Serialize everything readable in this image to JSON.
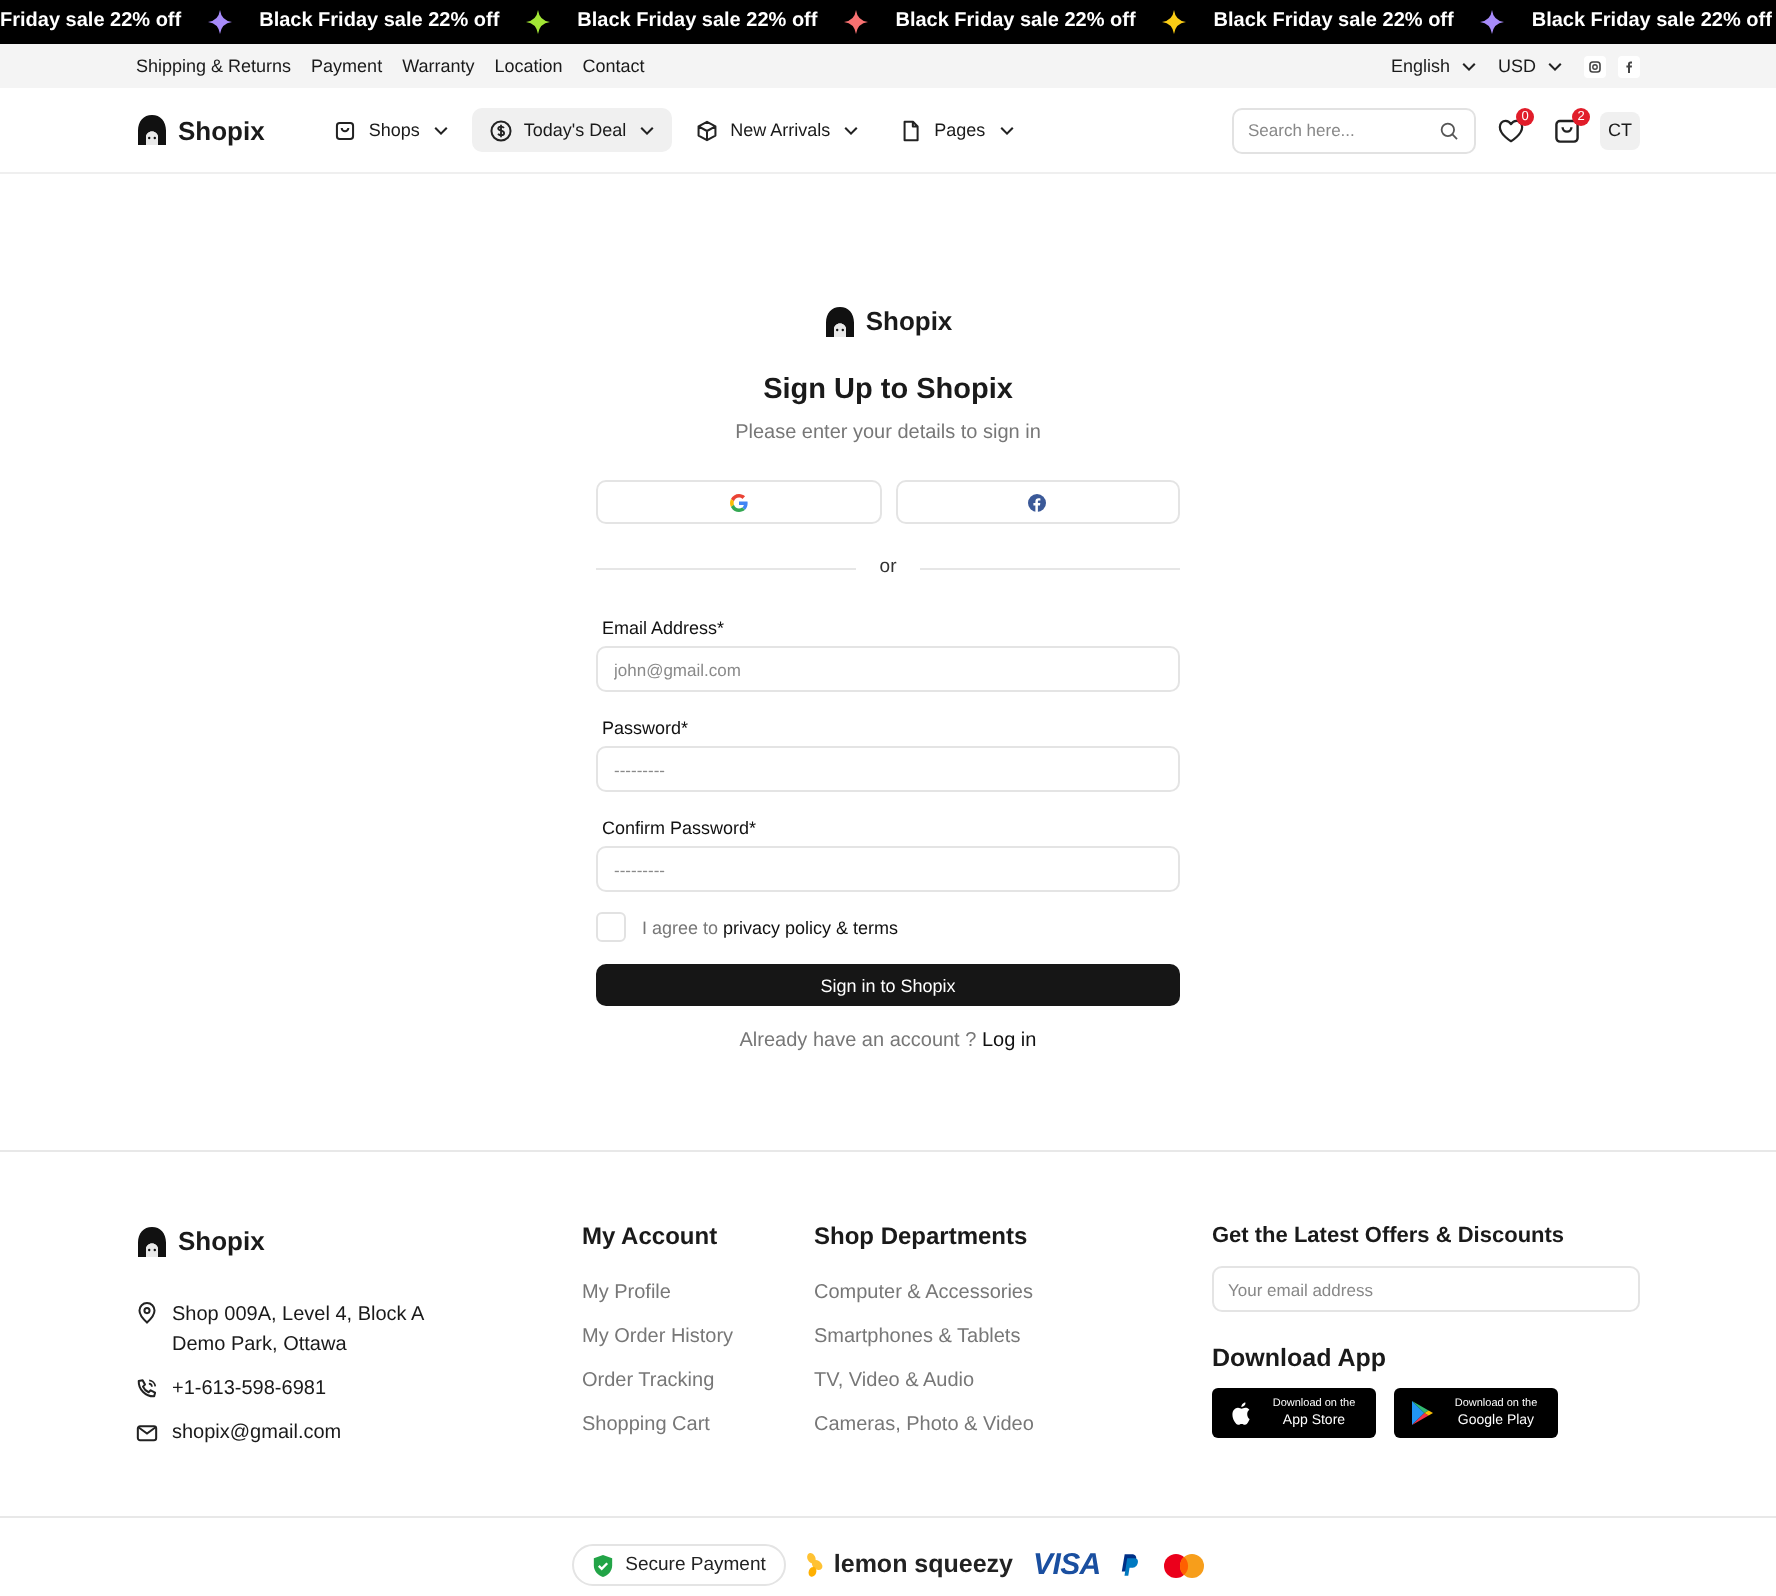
{
  "ticker": {
    "items": [
      {
        "kind": "text",
        "text": "Friday sale 22% off"
      },
      {
        "kind": "star",
        "color": "#a78bfa"
      },
      {
        "kind": "text",
        "text": "Black Friday sale 22% off"
      },
      {
        "kind": "star",
        "color": "#a3e635"
      },
      {
        "kind": "text",
        "text": "Black Friday sale 22% off"
      },
      {
        "kind": "star",
        "color": "#f87171"
      },
      {
        "kind": "text",
        "text": "Black Friday sale 22% off"
      },
      {
        "kind": "star",
        "color": "#facc15"
      },
      {
        "kind": "text",
        "text": "Black Friday sale 22% off"
      },
      {
        "kind": "star",
        "color": "#a78bfa"
      },
      {
        "kind": "text",
        "text": "Black Friday sale 22% off"
      }
    ]
  },
  "utility_bar": {
    "links": [
      "Shipping & Returns",
      "Payment",
      "Warranty",
      "Location",
      "Contact"
    ],
    "language": "English",
    "currency": "USD"
  },
  "header": {
    "logo": "Shopix",
    "nav": [
      {
        "label": "Shops",
        "selected": false
      },
      {
        "label": "Today's Deal",
        "selected": true
      },
      {
        "label": "New Arrivals",
        "selected": false
      },
      {
        "label": "Pages",
        "selected": false
      }
    ],
    "search": {
      "placeholder": "Search here..."
    },
    "wishlist_count": "0",
    "cart_count": "2",
    "avatar": "CT"
  },
  "signup": {
    "logo": "Shopix",
    "title": "Sign Up to Shopix",
    "subtitle": "Please enter your details to sign in",
    "divider": "or",
    "fields": [
      {
        "label": "Email Address*",
        "placeholder": "john@gmail.com"
      },
      {
        "label": "Password*",
        "placeholder": "---------"
      },
      {
        "label": "Confirm Password*",
        "placeholder": "---------"
      }
    ],
    "agree": {
      "checked": false,
      "text": "I agree to",
      "link": "privacy policy & terms"
    },
    "submit": "Sign in to Shopix",
    "login_prompt": {
      "text": "Already have an account ?",
      "link": "Log in"
    }
  },
  "footer": {
    "logo": "Shopix",
    "address": [
      "Shop 009A, Level 4, Block A",
      "Demo Park, Ottawa"
    ],
    "phone": "+1-613-598-6981",
    "email": "shopix@gmail.com",
    "columns": [
      {
        "title": "My Account",
        "links": [
          "My Profile",
          "My Order History",
          "Order Tracking",
          "Shopping Cart"
        ]
      },
      {
        "title": "Shop Departments",
        "links": [
          "Computer & Accessories",
          "Smartphones & Tablets",
          "TV, Video & Audio",
          "Cameras, Photo & Video"
        ]
      }
    ],
    "newsletter": {
      "title": "Get the Latest Offers & Discounts",
      "placeholder": "Your email address"
    },
    "apps": {
      "title": "Download App",
      "badges": [
        {
          "kind": "apple",
          "small": "Download on the",
          "name": "App Store"
        },
        {
          "kind": "google",
          "small": "Download on the",
          "name": "Google Play"
        }
      ]
    }
  },
  "payments": {
    "secure": "Secure Payment",
    "providers": [
      {
        "kind": "lemon",
        "text": "lemon squeezy"
      },
      {
        "kind": "visa",
        "text": "VISA"
      },
      {
        "kind": "paypal"
      },
      {
        "kind": "mastercard"
      }
    ]
  }
}
